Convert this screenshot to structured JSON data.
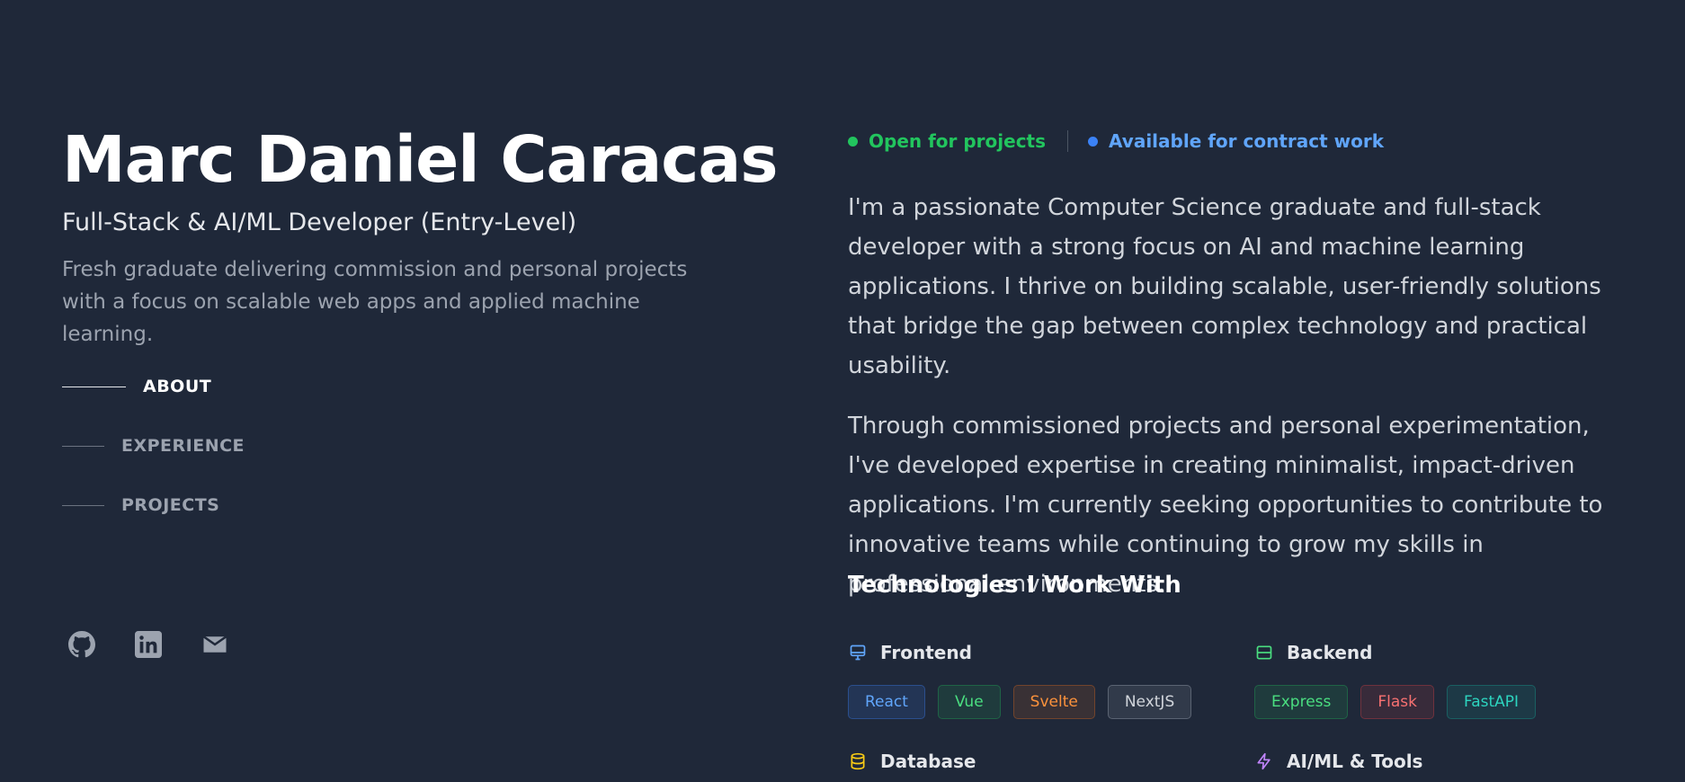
{
  "profile": {
    "name": "Marc Daniel Caracas",
    "role": "Full-Stack & AI/ML Developer (Entry-Level)",
    "tagline": "Fresh graduate delivering commission and personal projects with a focus on scalable web apps and applied machine learning."
  },
  "nav": {
    "items": [
      {
        "label": "ABOUT",
        "active": true
      },
      {
        "label": "EXPERIENCE",
        "active": false
      },
      {
        "label": "PROJECTS",
        "active": false
      }
    ]
  },
  "socials": [
    {
      "icon": "github-icon"
    },
    {
      "icon": "linkedin-icon"
    },
    {
      "icon": "mail-icon"
    }
  ],
  "status": {
    "open": {
      "label": "Open for projects",
      "color": "#22c55e"
    },
    "contract": {
      "label": "Available for contract work",
      "color": "#3b82f6"
    }
  },
  "about": {
    "paragraphs": [
      "I'm a passionate Computer Science graduate and full-stack developer with a strong focus on AI and machine learning applications. I thrive on building scalable, user-friendly solutions that bridge the gap between complex technology and practical usability.",
      "Through commissioned projects and personal experimentation, I've developed expertise in creating minimalist, impact-driven applications. I'm currently seeking opportunities to contribute to innovative teams while continuing to grow my skills in professional environments."
    ]
  },
  "technologies": {
    "title": "Technologies I Work With",
    "categories": [
      {
        "name": "Frontend",
        "icon": "monitor-icon",
        "icon_color": "#60a5fa",
        "chips": [
          {
            "label": "React",
            "color": "#60a5fa"
          },
          {
            "label": "Vue",
            "color": "#4ade80"
          },
          {
            "label": "Svelte",
            "color": "#fb923c"
          },
          {
            "label": "NextJS",
            "color": "#d1d5db"
          }
        ]
      },
      {
        "name": "Backend",
        "icon": "server-icon",
        "icon_color": "#4ade80",
        "chips": [
          {
            "label": "Express",
            "color": "#4ade80"
          },
          {
            "label": "Flask",
            "color": "#f87171"
          },
          {
            "label": "FastAPI",
            "color": "#2dd4bf"
          }
        ]
      },
      {
        "name": "Database",
        "icon": "database-icon",
        "icon_color": "#facc15",
        "chips": []
      },
      {
        "name": "AI/ML & Tools",
        "icon": "lightning-icon",
        "icon_color": "#c084fc",
        "chips": []
      }
    ]
  }
}
